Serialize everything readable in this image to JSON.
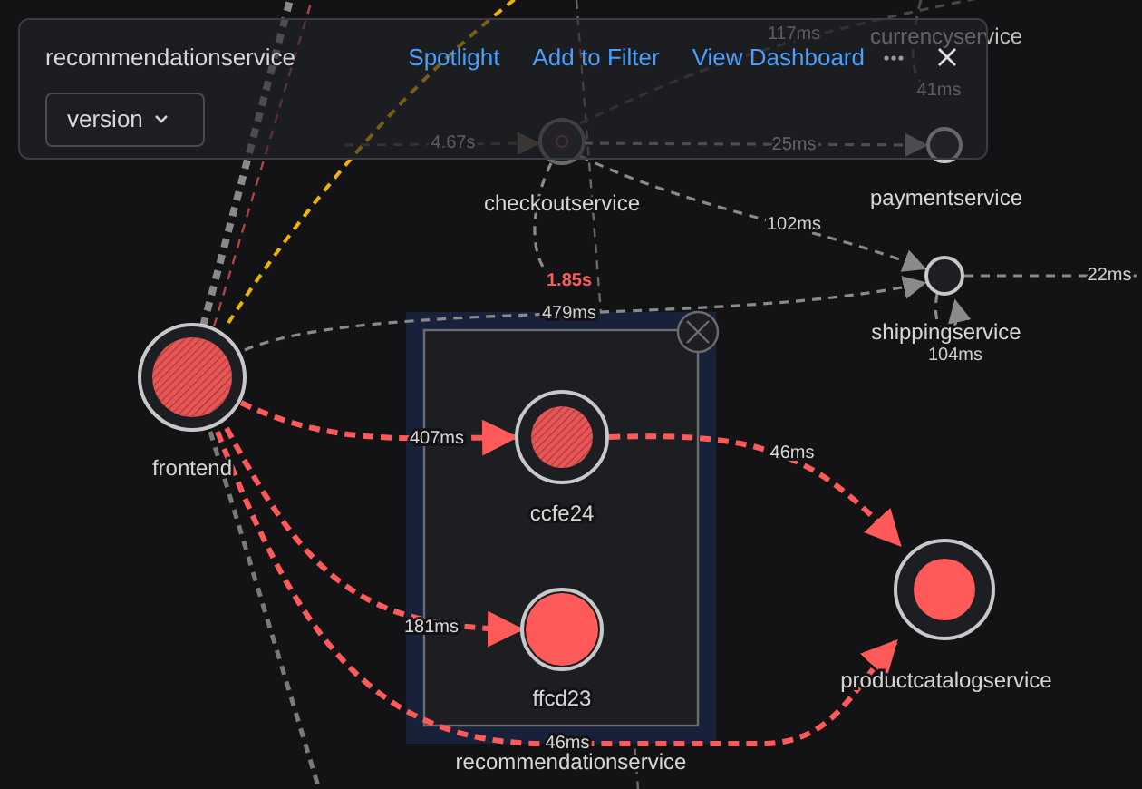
{
  "panel": {
    "title": "recommendationservice",
    "actions": [
      "Spotlight",
      "Add to Filter",
      "View Dashboard"
    ],
    "dropdown": {
      "label": "version"
    }
  },
  "nodes": [
    {
      "label": "frontend",
      "kind": "hatched"
    },
    {
      "label": "checkoutservice",
      "kind": "faded"
    },
    {
      "label": "currencyservice",
      "kind": "offscreen"
    },
    {
      "label": "paymentservice",
      "kind": "empty"
    },
    {
      "label": "shippingservice",
      "kind": "empty"
    },
    {
      "label": "ccfe24",
      "kind": "hatched"
    },
    {
      "label": "ffcd23",
      "kind": "solid"
    },
    {
      "label": "productcatalogservice",
      "kind": "solid"
    }
  ],
  "group": {
    "label": "recommendationservice"
  },
  "edges": [
    {
      "label": "4.67s",
      "kind": "faded",
      "slow": false
    },
    {
      "label": "117ms",
      "kind": "faded",
      "slow": false
    },
    {
      "label": "41ms",
      "kind": "faded",
      "slow": false
    },
    {
      "label": "25ms",
      "kind": "normal",
      "slow": false
    },
    {
      "label": "102ms",
      "kind": "normal",
      "slow": false
    },
    {
      "label": "1.85s",
      "kind": "normal",
      "slow": true
    },
    {
      "label": "479ms",
      "kind": "normal",
      "slow": false
    },
    {
      "label": "22ms",
      "kind": "normal",
      "slow": false
    },
    {
      "label": "104ms",
      "kind": "normal",
      "slow": false
    },
    {
      "label": "407ms",
      "kind": "error",
      "slow": false
    },
    {
      "label": "181ms",
      "kind": "error",
      "slow": false
    },
    {
      "label": "46ms",
      "kind": "error",
      "slow": false
    },
    {
      "label": "46ms",
      "kind": "error",
      "slow": false
    }
  ]
}
